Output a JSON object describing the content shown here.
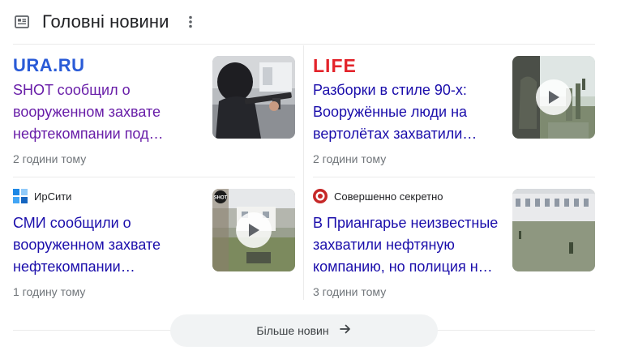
{
  "header": {
    "title": "Головні новини",
    "icon": "newspaper-icon",
    "menu_icon": "more-vert-icon"
  },
  "cards": [
    {
      "source": "URA.RU",
      "source_color": "#2a5bd7",
      "headline": "SHOT сообщил о вооруженном захвате нефтекомпании под…",
      "time": "2 години тому",
      "has_video": false
    },
    {
      "source": "LIFE",
      "source_color": "#e3242b",
      "headline": "Разборки в стиле 90-х: Вооружённые люди на вертолётах захватили…",
      "time": "2 години тому",
      "has_video": true
    },
    {
      "source": "ИрСити",
      "source_color": "#1e88e5",
      "headline": "СМИ сообщили о вооруженном захвате нефтекомпании…",
      "time": "1 годину тому",
      "has_video": true,
      "thumb_badge": "SHOT"
    },
    {
      "source": "Совершенно секретно",
      "source_color": "#c62828",
      "headline": "В Приангарье неизвестные захватили нефтяную компанию, но полиция н…",
      "time": "3 години тому",
      "has_video": false
    }
  ],
  "more_button": {
    "label": "Більше новин",
    "icon": "arrow-right-icon"
  },
  "colors": {
    "visited_link": "#681da8",
    "link": "#1a0dab",
    "meta_text": "#70757a",
    "divider": "#ebebeb"
  }
}
